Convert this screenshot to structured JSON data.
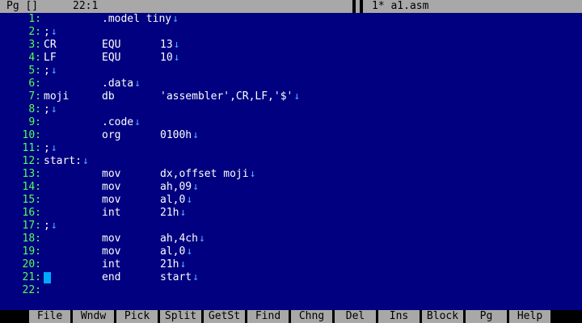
{
  "status": {
    "mode": "Pg []",
    "position": "22:1",
    "filename": "1* a1.asm"
  },
  "eol_glyph": "↓",
  "lines": [
    {
      "num": "1:",
      "label": "",
      "mnemonic": ".model tiny",
      "operand": ""
    },
    {
      "num": "2:",
      "label": ";",
      "mnemonic": "",
      "operand": ""
    },
    {
      "num": "3:",
      "label": "CR",
      "mnemonic": "EQU",
      "operand": "13"
    },
    {
      "num": "4:",
      "label": "LF",
      "mnemonic": "EQU",
      "operand": "10"
    },
    {
      "num": "5:",
      "label": ";",
      "mnemonic": "",
      "operand": ""
    },
    {
      "num": "6:",
      "label": "",
      "mnemonic": ".data",
      "operand": ""
    },
    {
      "num": "7:",
      "label": "moji",
      "mnemonic": "db",
      "operand": "'assembler',CR,LF,'$'"
    },
    {
      "num": "8:",
      "label": ";",
      "mnemonic": "",
      "operand": ""
    },
    {
      "num": "9:",
      "label": "",
      "mnemonic": ".code",
      "operand": ""
    },
    {
      "num": "10:",
      "label": "",
      "mnemonic": "org",
      "operand": "0100h"
    },
    {
      "num": "11:",
      "label": ";",
      "mnemonic": "",
      "operand": ""
    },
    {
      "num": "12:",
      "label": "start:",
      "mnemonic": "",
      "operand": ""
    },
    {
      "num": "13:",
      "label": "",
      "mnemonic": "mov",
      "operand": "dx,offset moji"
    },
    {
      "num": "14:",
      "label": "",
      "mnemonic": "mov",
      "operand": "ah,09"
    },
    {
      "num": "15:",
      "label": "",
      "mnemonic": "mov",
      "operand": "al,0"
    },
    {
      "num": "16:",
      "label": "",
      "mnemonic": "int",
      "operand": "21h"
    },
    {
      "num": "17:",
      "label": ";",
      "mnemonic": "",
      "operand": ""
    },
    {
      "num": "18:",
      "label": "",
      "mnemonic": "mov",
      "operand": "ah,4ch"
    },
    {
      "num": "19:",
      "label": "",
      "mnemonic": "mov",
      "operand": "al,0"
    },
    {
      "num": "20:",
      "label": "",
      "mnemonic": "int",
      "operand": "21h"
    },
    {
      "num": "21:",
      "label": "",
      "mnemonic": "end",
      "operand": "start"
    },
    {
      "num": "22:",
      "label": "",
      "mnemonic": "",
      "operand": ""
    }
  ],
  "function_keys": [
    "File",
    "Wndw",
    "Pick",
    "Split",
    "GetSt",
    "Find",
    "Chng",
    "Del",
    "Ins",
    "Block",
    "Pg",
    "Help"
  ],
  "colors": {
    "editor_bg": "#000080",
    "line_number": "#55ff55",
    "code_text": "#ffffff",
    "eol_marker": "#55aaff",
    "cursor": "#00aaff",
    "bar_bg": "#a8a8a8"
  }
}
